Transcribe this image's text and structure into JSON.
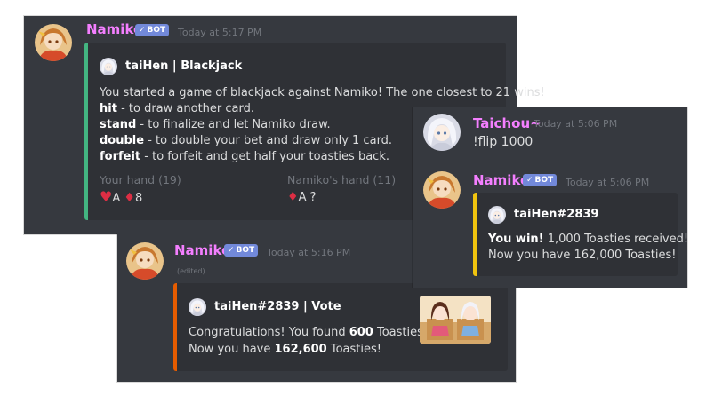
{
  "colors": {
    "namiko": "#f47fff",
    "taichou": "#f47fff",
    "blackjack_bar": "#43b581",
    "vote_bar": "#e65c00",
    "flip_bar": "#f1c40f",
    "badge": "#7289da"
  },
  "blackjack": {
    "username": "Namiko",
    "badge": "BOT",
    "timestamp": "Today at 5:17 PM",
    "embed_author": "taiHen | Blackjack",
    "intro": "You started a game of blackjack against Namiko! The one closest to 21 wins!",
    "cmds": [
      {
        "cmd": "hit",
        "desc": " - to draw another card."
      },
      {
        "cmd": "stand",
        "desc": " - to finalize and let Namiko draw."
      },
      {
        "cmd": "double",
        "desc": " - to double your bet and draw only 1 card."
      },
      {
        "cmd": "forfeit",
        "desc": " - to forfeit and get half your toasties back."
      }
    ],
    "your_hand_label": "Your hand (19)",
    "your_cards": [
      {
        "suit": "heart-icon",
        "rank": "A"
      },
      {
        "suit": "diamond-icon",
        "rank": "8"
      }
    ],
    "namiko_hand_label": "Namiko's hand (11)",
    "namiko_cards": [
      {
        "suit": "diamond-icon",
        "rank": "A ?"
      }
    ]
  },
  "vote": {
    "username": "Namiko",
    "badge": "BOT",
    "timestamp": "Today at 5:16 PM",
    "edited": "(edited)",
    "embed_author": "taiHen#2839 | Vote",
    "line1_pre": "Congratulations! You found ",
    "line1_bold": "600",
    "line1_post": " Toasties!",
    "line2_pre": "Now you have ",
    "line2_bold": "162,600",
    "line2_post": " Toasties!"
  },
  "flip": {
    "user": "Taichou~",
    "user_timestamp": "Today at 5:06 PM",
    "command": "!flip 1000",
    "bot": "Namiko",
    "badge": "BOT",
    "bot_timestamp": "Today at 5:06 PM",
    "embed_author": "taiHen#2839",
    "line1_bold": "You win!",
    "line1_post": " 1,000 Toasties received!",
    "line2": "Now you have 162,000 Toasties!"
  }
}
